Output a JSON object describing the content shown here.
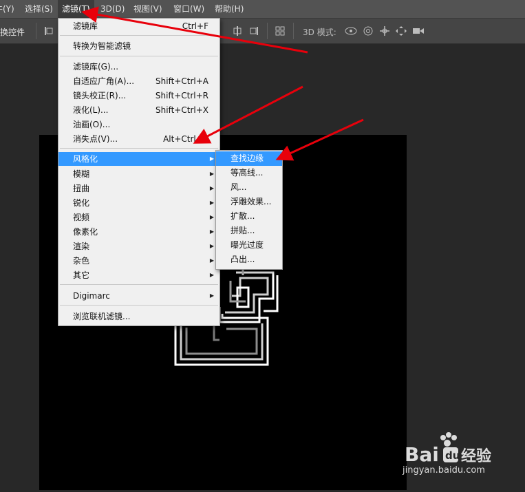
{
  "menubar": {
    "items": [
      {
        "label": "牛(Y)"
      },
      {
        "label": "选择(S)"
      },
      {
        "label": "滤镜(T)"
      },
      {
        "label": "3D(D)"
      },
      {
        "label": "视图(V)"
      },
      {
        "label": "窗口(W)"
      },
      {
        "label": "帮助(H)"
      }
    ]
  },
  "options_bar": {
    "transform_label": "换控件",
    "mode_label": "3D 模式:"
  },
  "filter_menu": {
    "items": [
      {
        "label": "滤镜库",
        "shortcut": "Ctrl+F"
      },
      {
        "label": "转换为智能滤镜"
      },
      {
        "label": "滤镜库(G)..."
      },
      {
        "label": "自适应广角(A)...",
        "shortcut": "Shift+Ctrl+A"
      },
      {
        "label": "镜头校正(R)...",
        "shortcut": "Shift+Ctrl+R"
      },
      {
        "label": "液化(L)...",
        "shortcut": "Shift+Ctrl+X"
      },
      {
        "label": "油画(O)..."
      },
      {
        "label": "消失点(V)...",
        "shortcut": "Alt+Ctrl+V"
      },
      {
        "label": "风格化"
      },
      {
        "label": "模糊"
      },
      {
        "label": "扭曲"
      },
      {
        "label": "锐化"
      },
      {
        "label": "视频"
      },
      {
        "label": "像素化"
      },
      {
        "label": "渲染"
      },
      {
        "label": "杂色"
      },
      {
        "label": "其它"
      },
      {
        "label": "Digimarc"
      },
      {
        "label": "浏览联机滤镜..."
      }
    ]
  },
  "stylize_submenu": {
    "items": [
      {
        "label": "查找边缘"
      },
      {
        "label": "等高线..."
      },
      {
        "label": "风..."
      },
      {
        "label": "浮雕效果..."
      },
      {
        "label": "扩散..."
      },
      {
        "label": "拼贴..."
      },
      {
        "label": "曝光过度"
      },
      {
        "label": "凸出..."
      }
    ]
  },
  "watermark": {
    "logo": "Bai 经验",
    "url": "jingyan.baidu.com"
  },
  "colors": {
    "highlight": "#3399ff",
    "arrow": "#e8000b",
    "menubar": "#535353",
    "canvas": "#000000"
  }
}
